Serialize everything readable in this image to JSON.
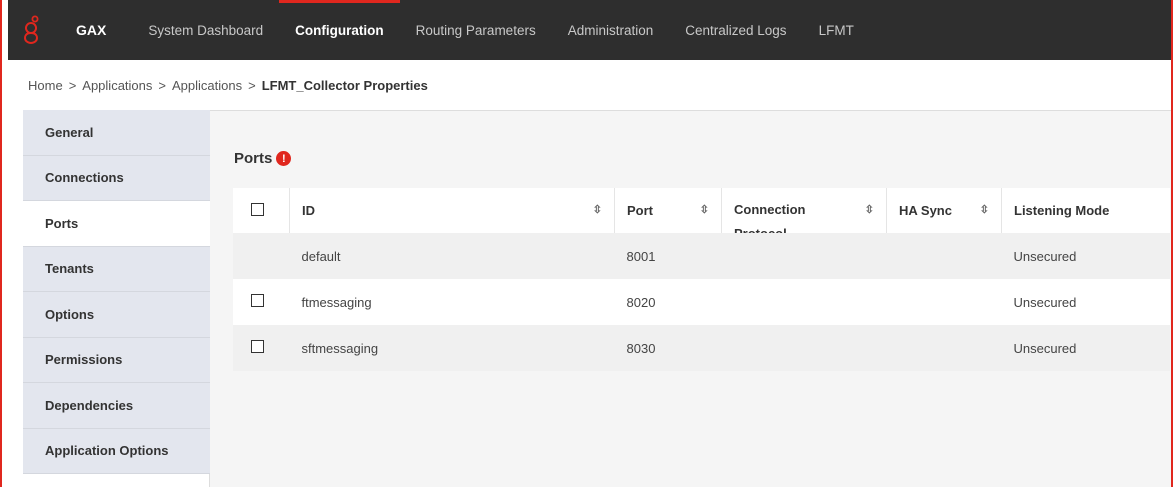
{
  "nav": {
    "brand": "GAX",
    "items": [
      {
        "label": "System Dashboard",
        "active": false
      },
      {
        "label": "Configuration",
        "active": true
      },
      {
        "label": "Routing Parameters",
        "active": false
      },
      {
        "label": "Administration",
        "active": false
      },
      {
        "label": "Centralized Logs",
        "active": false
      },
      {
        "label": "LFMT",
        "active": false
      }
    ],
    "accent_color": "#e0271e"
  },
  "breadcrumb": {
    "items": [
      "Home",
      "Applications",
      "Applications"
    ],
    "separator": ">",
    "current": "LFMT_Collector Properties"
  },
  "sidebar": {
    "items": [
      {
        "label": "General",
        "active": false
      },
      {
        "label": "Connections",
        "active": false
      },
      {
        "label": "Ports",
        "active": true
      },
      {
        "label": "Tenants",
        "active": false
      },
      {
        "label": "Options",
        "active": false
      },
      {
        "label": "Permissions",
        "active": false
      },
      {
        "label": "Dependencies",
        "active": false
      },
      {
        "label": "Application Options",
        "active": false
      }
    ]
  },
  "ports": {
    "title": "Ports",
    "warning_icon": "exclamation-circle-icon",
    "columns": [
      "ID",
      "Port",
      "Connection Protocol",
      "HA Sync",
      "Listening Mode"
    ],
    "rows": [
      {
        "id": "default",
        "port": "8001",
        "protocol": "",
        "ha_sync": "",
        "listening_mode": "Unsecured",
        "checkbox": false
      },
      {
        "id": "ftmessaging",
        "port": "8020",
        "protocol": "",
        "ha_sync": "",
        "listening_mode": "Unsecured",
        "checkbox": true
      },
      {
        "id": "sftmessaging",
        "port": "8030",
        "protocol": "",
        "ha_sync": "",
        "listening_mode": "Unsecured",
        "checkbox": true
      }
    ]
  }
}
